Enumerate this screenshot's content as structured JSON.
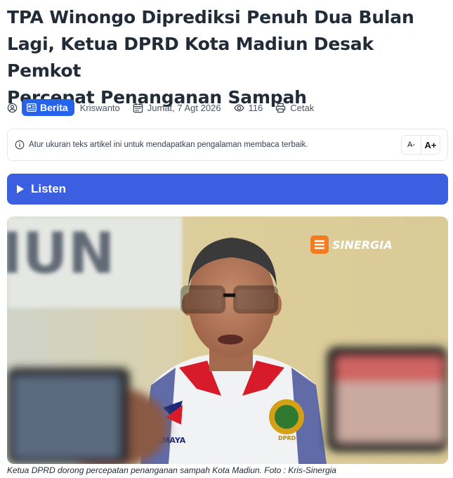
{
  "article": {
    "title": "TPA Winongo Diprediksi Penuh Dua Bulan Lagi, Ketua DPRD Kota Madiun Desak Pemkot Percepat Penanganan Sampah",
    "title_lines": [
      "TPA Winongo Diprediksi Penuh Dua Bulan",
      "Lagi, Ketua DPRD Kota Madiun Desak Pemkot",
      "Percepat Penanganan Sampah"
    ],
    "category": "Berita",
    "author": "Kriswanto",
    "date": "Jumat, 7 Agt 2026",
    "views": "116",
    "print_label": "Cetak"
  },
  "icons": {
    "author": "user-circle-icon",
    "category": "newspaper-icon",
    "date": "calendar-icon",
    "views": "eye-icon",
    "print": "printer-icon",
    "info": "info-icon",
    "play": "play-icon"
  },
  "font_size_bar": {
    "text": "Atur ukuran teks artikel ini untuk mendapatkan pengalaman membaca terbaik.",
    "decrease_label": "A-",
    "increase_label": "A+"
  },
  "listen": {
    "label": "Listen"
  },
  "photo": {
    "wall_text": "IUN",
    "watermark": "SINERGIA",
    "patch_left": "RMAYA",
    "patch_right": "DPRD",
    "caption": "Ketua DPRD dorong percepatan penanganan sampah Kota Madiun. Foto : Kris-Sinergia"
  },
  "colors": {
    "accent": "#2563eb",
    "listen_bg": "#3b5fe0",
    "watermark_orange": "#f47b20"
  }
}
